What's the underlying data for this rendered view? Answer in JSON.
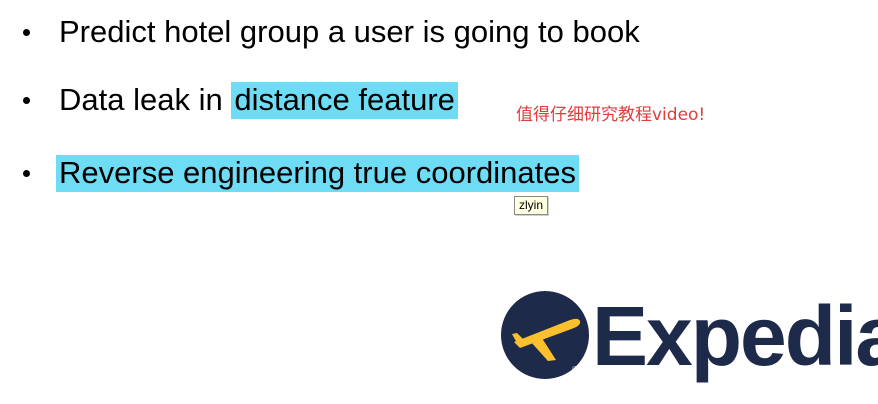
{
  "bullets": [
    {
      "text": "Predict hotel group a user is going to book"
    },
    {
      "prefix": "Data leak in ",
      "highlight": "distance feature"
    },
    {
      "highlight": "Reverse engineering true coordinates"
    }
  ],
  "annotation": {
    "text": "值得仔细研究教程video!"
  },
  "tooltip": {
    "label": "zlyin"
  },
  "logo": {
    "wordmark": "Expedia",
    "registered": "®"
  },
  "colors": {
    "highlight": "#6fdcf5",
    "annotation": "#e03c3c",
    "logo_navy": "#1e2a4a",
    "logo_yellow": "#fbc02d"
  }
}
